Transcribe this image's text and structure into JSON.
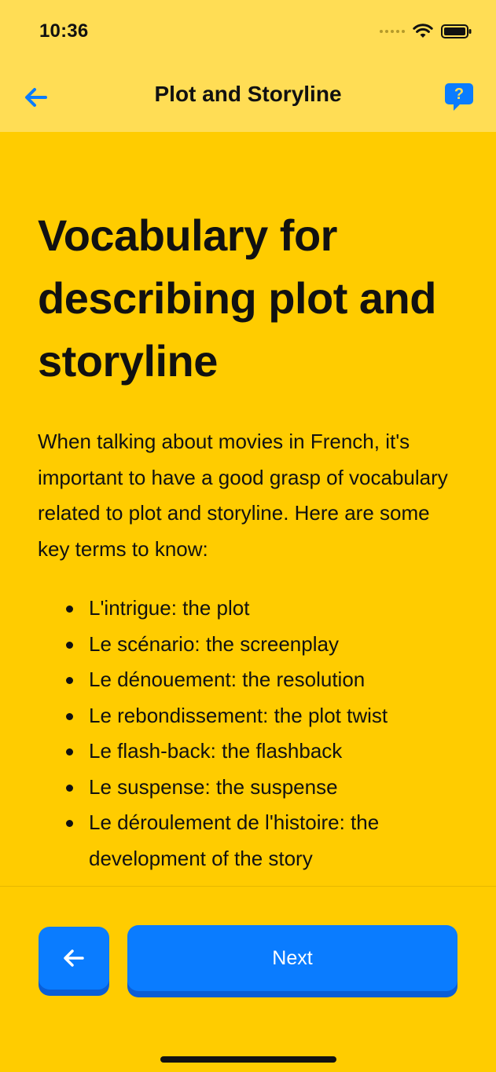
{
  "status_bar": {
    "time": "10:36"
  },
  "nav": {
    "title": "Plot and Storyline"
  },
  "lesson": {
    "heading": "Vocabulary for describing plot and storyline",
    "intro": "When talking about movies in French, it's important to have a good grasp of vocabulary related to plot and storyline. Here are some key terms to know:",
    "terms": [
      "L'intrigue: the plot",
      "Le scénario: the screenplay",
      "Le dénouement: the resolution",
      "Le rebondissement: the plot twist",
      "Le flash-back: the flashback",
      "Le suspense: the suspense",
      "Le déroulement de l'histoire: the development of the story"
    ]
  },
  "footer": {
    "next_label": "Next"
  },
  "icons": {
    "back": "arrow-left-icon",
    "help": "question-bubble-icon",
    "prev": "arrow-left-icon"
  },
  "colors": {
    "background": "#FFCC00",
    "header": "#FFDD55",
    "accent": "#0A7CFF"
  }
}
